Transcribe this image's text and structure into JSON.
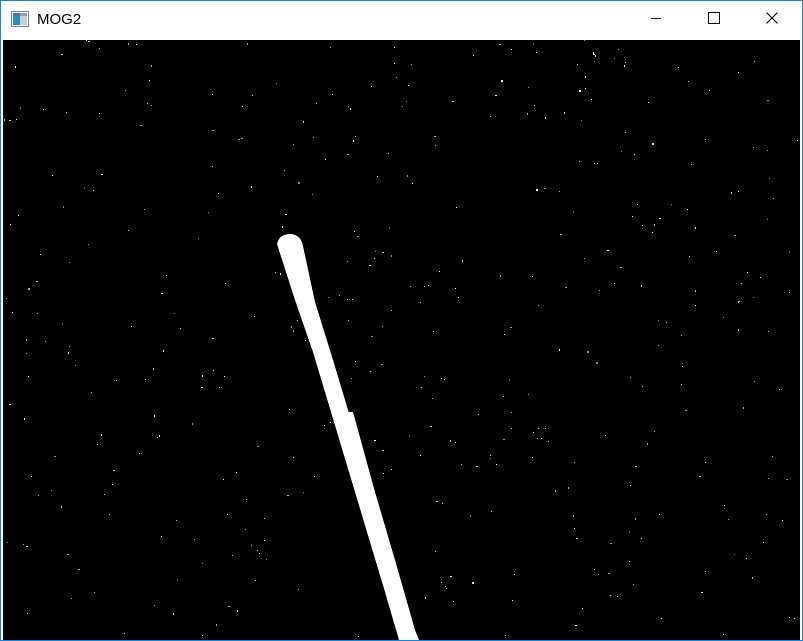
{
  "window": {
    "title": "MOG2",
    "accent_color": "#1883d7",
    "icons": {
      "app": "opencv-window-icon",
      "minimize": "minimize-icon",
      "maximize": "maximize-icon",
      "close": "close-icon"
    }
  },
  "image": {
    "description_type": "foreground-mask",
    "background_color": "#000000",
    "foreground_color": "#ffffff"
  }
}
